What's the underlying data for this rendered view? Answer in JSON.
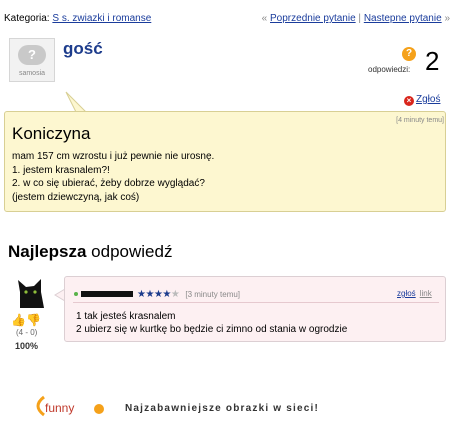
{
  "header": {
    "category_label": "Kategoria:",
    "category_link": "S s. zwiazki i romanse",
    "prev_label": "Poprzednie pytanie",
    "next_label": "Nastepne pytanie",
    "prev_arrow": "«",
    "next_arrow": "»",
    "separator": "|"
  },
  "question": {
    "avatar_brand": "samosia",
    "avatar_glyph": "?",
    "author": "gość",
    "answers_label": "odpowiedzi:",
    "answers_icon": "?",
    "answers_count": "2",
    "report_label": "Zgłoś",
    "time": "[4 minuty temu]",
    "title": "Koniczyna",
    "lines": [
      "mam 157 cm wzrostu i już pewnie nie urosnę.",
      "1. jestem krasnalem?!",
      "2. w co się ubierać, żeby dobrze wyglądać?",
      "(jestem dziewczyną, jak coś)"
    ]
  },
  "best_answer": {
    "heading_bold": "Najlepsza",
    "heading_rest": " odpowiedź",
    "votes": "(4 - 0)",
    "percent": "100%",
    "rating_stars": 3.5,
    "time": "[3 minuty temu]",
    "report_label": "zgłoś",
    "link_label": "link",
    "lines": [
      "1 tak jesteś krasnalem",
      "2 ubierz się w kurtkę bo będzie ci zimno od stania w ogrodzie"
    ]
  },
  "footer": {
    "logo_text": "funny",
    "slogan": "Najzabawniejsze obrazki w sieci!"
  },
  "colors": {
    "link": "#1a3c9c",
    "question_bg": "#fdf7d0",
    "answer_bg": "#fdf0f2",
    "accent_orange": "#f5a11a",
    "report_red": "#d9261c"
  }
}
